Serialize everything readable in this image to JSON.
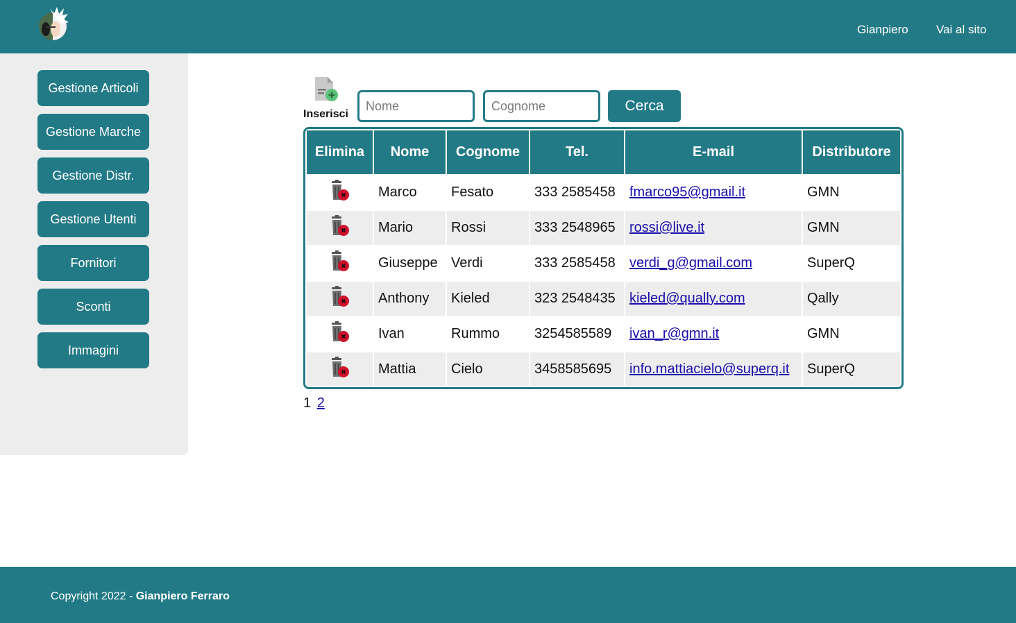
{
  "header": {
    "user_label": "Gianpiero",
    "site_link": "Vai al sito",
    "logo_icon": "avatar-logo-icon"
  },
  "sidebar": {
    "items": [
      {
        "label": "Gestione Articoli"
      },
      {
        "label": "Gestione Marche"
      },
      {
        "label": "Gestione Distr."
      },
      {
        "label": "Gestione Utenti"
      },
      {
        "label": "Fornitori"
      },
      {
        "label": "Sconti"
      },
      {
        "label": "Immagini"
      }
    ]
  },
  "toolbar": {
    "insert_label": "Inserisci",
    "insert_icon": "add-document-icon",
    "nome_placeholder": "Nome",
    "cognome_placeholder": "Cognome",
    "search_label": "Cerca"
  },
  "table": {
    "headers": [
      "Elimina",
      "Nome",
      "Cognome",
      "Tel.",
      "E-mail",
      "Distributore"
    ],
    "delete_icon": "trash-delete-icon",
    "rows": [
      {
        "nome": "Marco",
        "cognome": "Fesato",
        "tel": "333 2585458",
        "email": "fmarco95@gmail.it",
        "distributore": "GMN"
      },
      {
        "nome": "Mario",
        "cognome": "Rossi",
        "tel": "333 2548965",
        "email": "rossi@live.it",
        "distributore": "GMN"
      },
      {
        "nome": "Giuseppe",
        "cognome": "Verdi",
        "tel": "333 2585458",
        "email": "verdi_g@gmail.com",
        "distributore": "SuperQ"
      },
      {
        "nome": "Anthony",
        "cognome": "Kieled",
        "tel": "323 2548435",
        "email": "kieled@qually.com",
        "distributore": "Qally"
      },
      {
        "nome": "Ivan",
        "cognome": "Rummo",
        "tel": "3254585589",
        "email": "ivan_r@gmn.it",
        "distributore": "GMN"
      },
      {
        "nome": "Mattia",
        "cognome": "Cielo",
        "tel": "3458585695",
        "email": "info.mattiacielo@superq.it",
        "distributore": "SuperQ"
      }
    ]
  },
  "pagination": {
    "current": "1",
    "pages": [
      "2"
    ]
  },
  "footer": {
    "copyright_prefix": "Copyright 2022 - ",
    "author": "Gianpiero Ferraro"
  },
  "colors": {
    "primary": "#237a87",
    "sidebar_bg": "#ededed",
    "row_alt": "#ededed",
    "delete_badge": "#d0102c"
  }
}
